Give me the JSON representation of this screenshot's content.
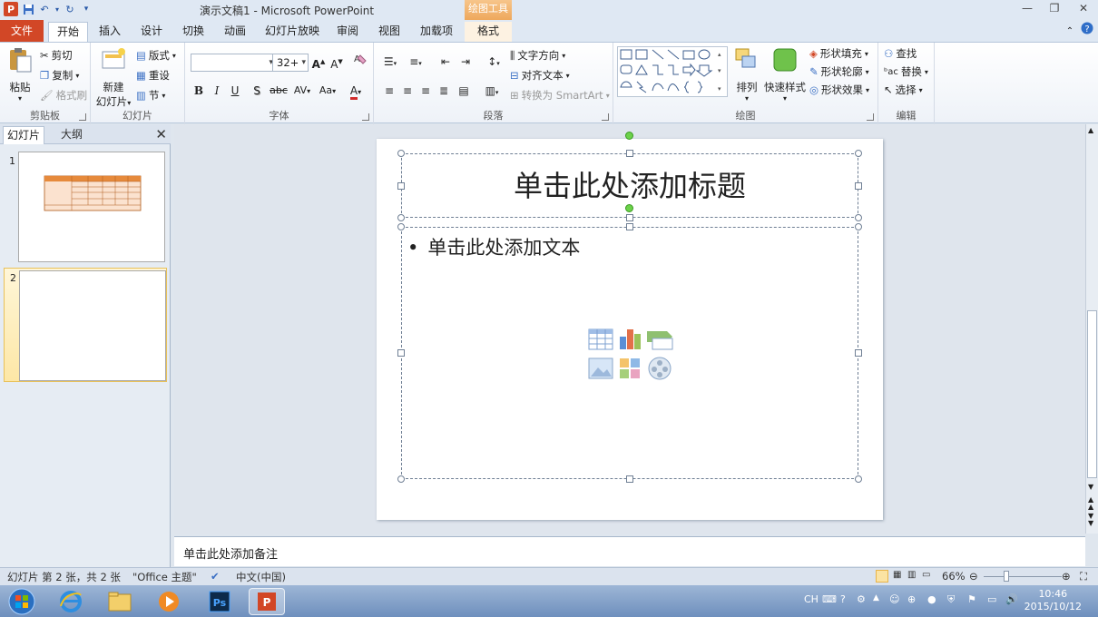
{
  "window": {
    "title": "演示文稿1 - Microsoft PowerPoint",
    "context_tab_header": "绘图工具"
  },
  "tabs": [
    "文件",
    "开始",
    "插入",
    "设计",
    "切换",
    "动画",
    "幻灯片放映",
    "审阅",
    "视图",
    "加载项",
    "格式"
  ],
  "ribbon": {
    "clipboard": {
      "label": "剪贴板",
      "paste": "粘贴",
      "cut": "剪切",
      "copy": "复制",
      "format_painter": "格式刷"
    },
    "slides": {
      "label": "幻灯片",
      "new_slide_1": "新建",
      "new_slide_2": "幻灯片",
      "layout": "版式",
      "reset": "重设",
      "section": "节"
    },
    "font": {
      "label": "字体",
      "font_name": "",
      "font_size": "32+",
      "bold": "B",
      "italic": "I",
      "underline": "U",
      "shadow": "S",
      "strike": "abc",
      "spacing": "AV",
      "case": "Aa",
      "color": "A"
    },
    "paragraph": {
      "label": "段落",
      "text_direction": "文字方向",
      "align_text": "对齐文本",
      "smartart": "转换为 SmartArt"
    },
    "drawing": {
      "label": "绘图",
      "arrange": "排列",
      "quick_styles": "快速样式",
      "shape_fill": "形状填充",
      "shape_outline": "形状轮廓",
      "shape_effects": "形状效果"
    },
    "editing": {
      "label": "编辑",
      "find": "查找",
      "replace": "替换",
      "select": "选择"
    }
  },
  "panel": {
    "tab_slides": "幻灯片",
    "tab_outline": "大纲",
    "close": "✕",
    "slides": [
      {
        "number": "1"
      },
      {
        "number": "2"
      }
    ]
  },
  "slide": {
    "title_placeholder": "单击此处添加标题",
    "bullet": "•",
    "body_placeholder": "单击此处添加文本"
  },
  "notes": {
    "placeholder": "单击此处添加备注"
  },
  "status": {
    "slide_info": "幻灯片 第 2 张，共 2 张",
    "theme": "\"Office 主题\"",
    "language": "中文(中国)",
    "zoom": "66%"
  },
  "taskbar": {
    "ime": "CH",
    "time": "10:46",
    "date": "2015/10/12"
  },
  "colors": {
    "file_tab": "#d24726",
    "context_tab": "#eea85c",
    "accent": "#2a5aa8"
  }
}
